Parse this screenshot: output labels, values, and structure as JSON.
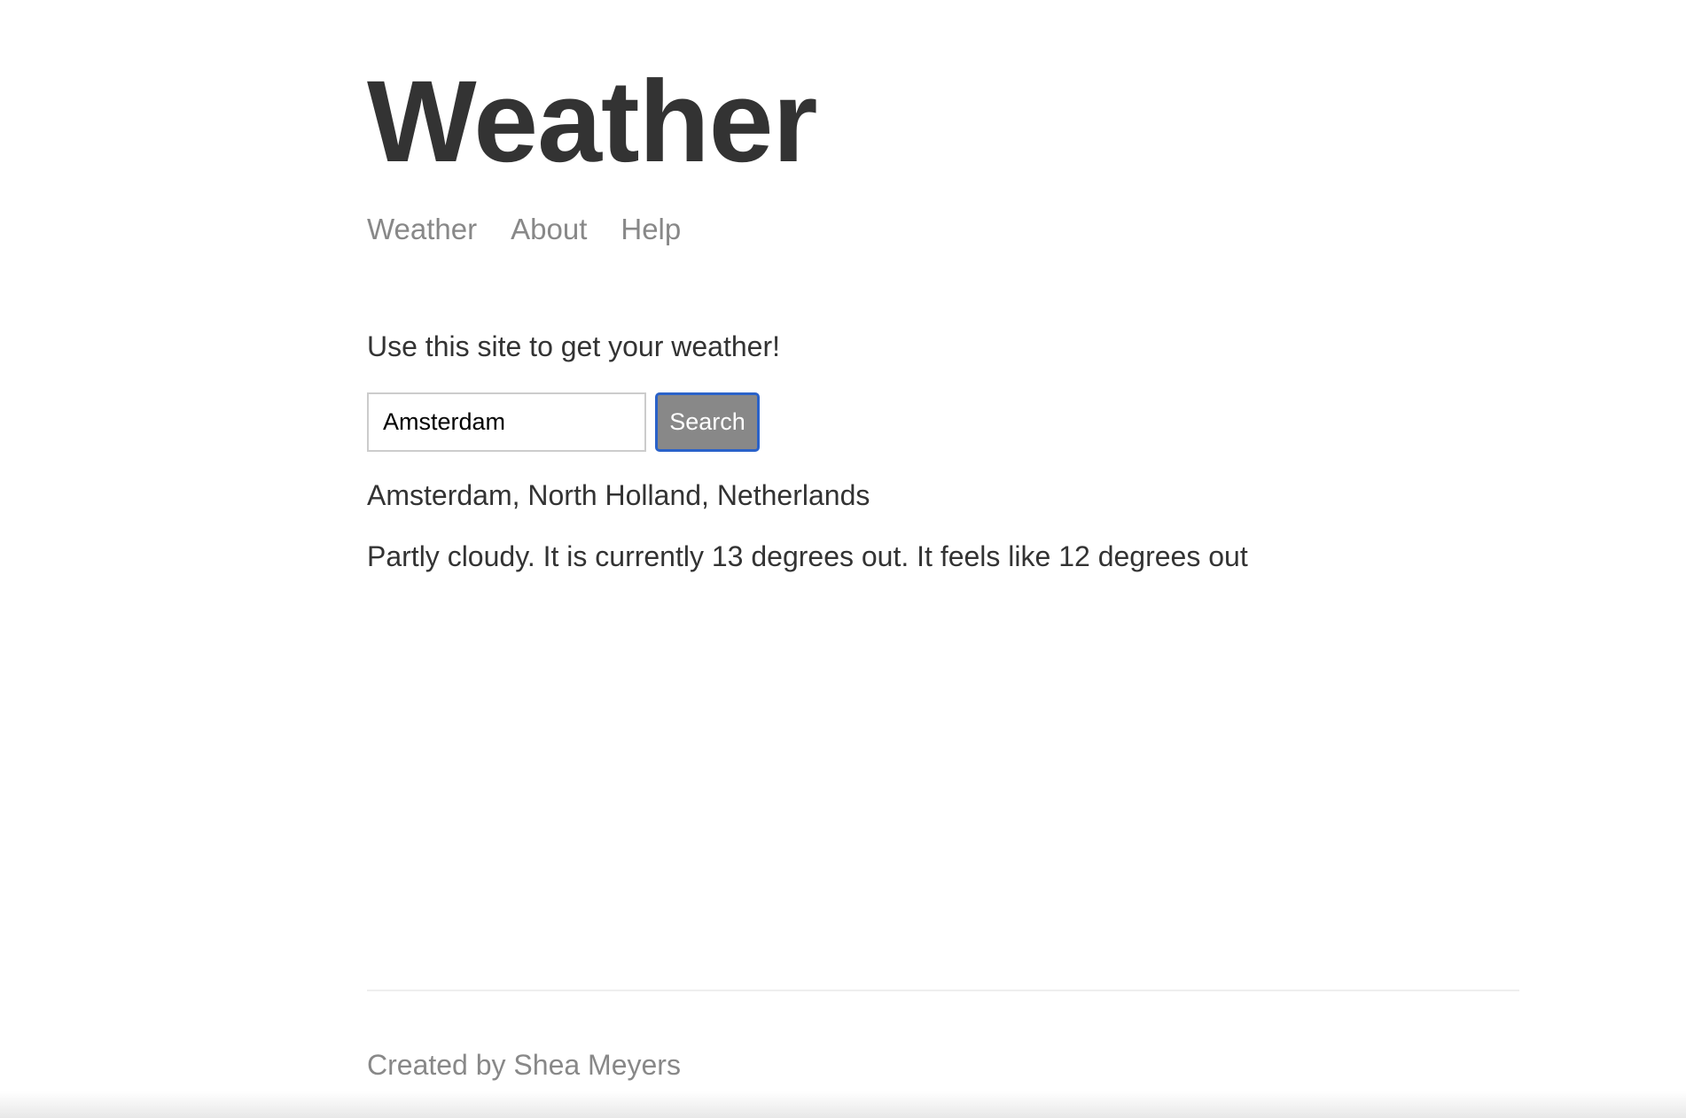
{
  "header": {
    "title": "Weather",
    "nav": [
      {
        "label": "Weather"
      },
      {
        "label": "About"
      },
      {
        "label": "Help"
      }
    ]
  },
  "main": {
    "intro": "Use this site to get your weather!",
    "search": {
      "value": "Amsterdam",
      "button_label": "Search"
    },
    "result": {
      "location": "Amsterdam, North Holland, Netherlands",
      "forecast": "Partly cloudy. It is currently 13 degrees out. It feels like 12 degrees out"
    }
  },
  "footer": {
    "credit": "Created by Shea Meyers"
  },
  "colors": {
    "text": "#333333",
    "muted": "#888888",
    "button_bg": "#888888",
    "focus_ring": "#2a62c9"
  }
}
